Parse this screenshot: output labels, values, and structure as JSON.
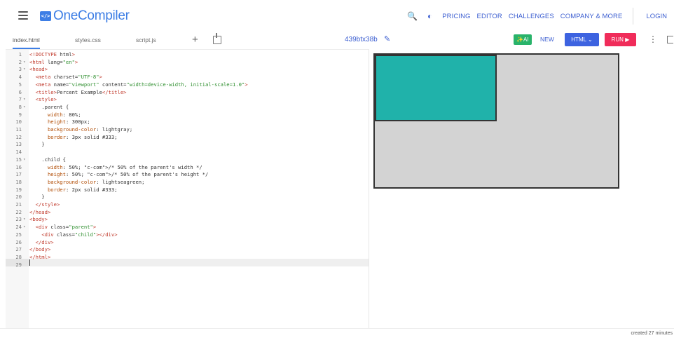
{
  "brand": {
    "logo_glyph": "</>",
    "name": "OneCompiler"
  },
  "nav": {
    "links": [
      "PRICING",
      "EDITOR",
      "CHALLENGES",
      "COMPANY & MORE"
    ],
    "login": "LOGIN"
  },
  "tabs": [
    "index.html",
    "styles.css",
    "script.js"
  ],
  "toolbar": {
    "add": "+",
    "project_name": "439btx38b",
    "ai_label": "AI",
    "new_label": "NEW",
    "language_label": "HTML",
    "run_label": "RUN"
  },
  "editor": {
    "lines": [
      "<!DOCTYPE html>",
      "<html lang=\"en\">",
      "<head>",
      "  <meta charset=\"UTF-8\">",
      "  <meta name=\"viewport\" content=\"width=device-width, initial-scale=1.0\">",
      "  <title>Percent Example</title>",
      "  <style>",
      "    .parent {",
      "      width: 80%;",
      "      height: 300px;",
      "      background-color: lightgray;",
      "      border: 3px solid #333;",
      "    }",
      "",
      "    .child {",
      "      width: 50%; /* 50% of the parent's width */",
      "      height: 50%; /* 50% of the parent's height */",
      "      background-color: lightseagreen;",
      "      border: 2px solid #333;",
      "    }",
      "  </style>",
      "</head>",
      "<body>",
      "  <div class=\"parent\">",
      "    <div class=\"child\"></div>",
      "  </div>",
      "</body>",
      "</html>",
      ""
    ],
    "line_numbers": [
      "1",
      "2",
      "3",
      "4",
      "5",
      "6",
      "7",
      "8",
      "9",
      "10",
      "11",
      "12",
      "13",
      "14",
      "15",
      "16",
      "17",
      "18",
      "19",
      "20",
      "21",
      "22",
      "23",
      "24",
      "25",
      "26",
      "27",
      "28",
      "29"
    ],
    "folds": [
      "",
      "▾",
      "▾",
      "",
      "",
      "",
      "▾",
      "▾",
      "",
      "",
      "",
      "",
      "",
      "",
      "▾",
      "",
      "",
      "",
      "",
      "",
      "",
      "",
      "▾",
      "▾",
      "",
      "",
      "",
      "",
      ""
    ]
  },
  "preview": {
    "parent_color": "#d3d3d3",
    "child_color": "#20b2aa",
    "border_color": "#333333"
  },
  "footer": {
    "created_text": "created 27 minutes"
  },
  "colors": {
    "brand": "#3d7ee5",
    "nav_link": "#3d5fd1",
    "ai": "#29b36a",
    "html_button": "#3d63e0",
    "run_button": "#f02c5a"
  },
  "icons": [
    "menu-icon",
    "search-icon",
    "theme-toggle-icon",
    "add-icon",
    "upload-icon",
    "pencil-icon",
    "chevron-down-icon",
    "play-icon",
    "kebab-icon",
    "fullscreen-icon"
  ]
}
